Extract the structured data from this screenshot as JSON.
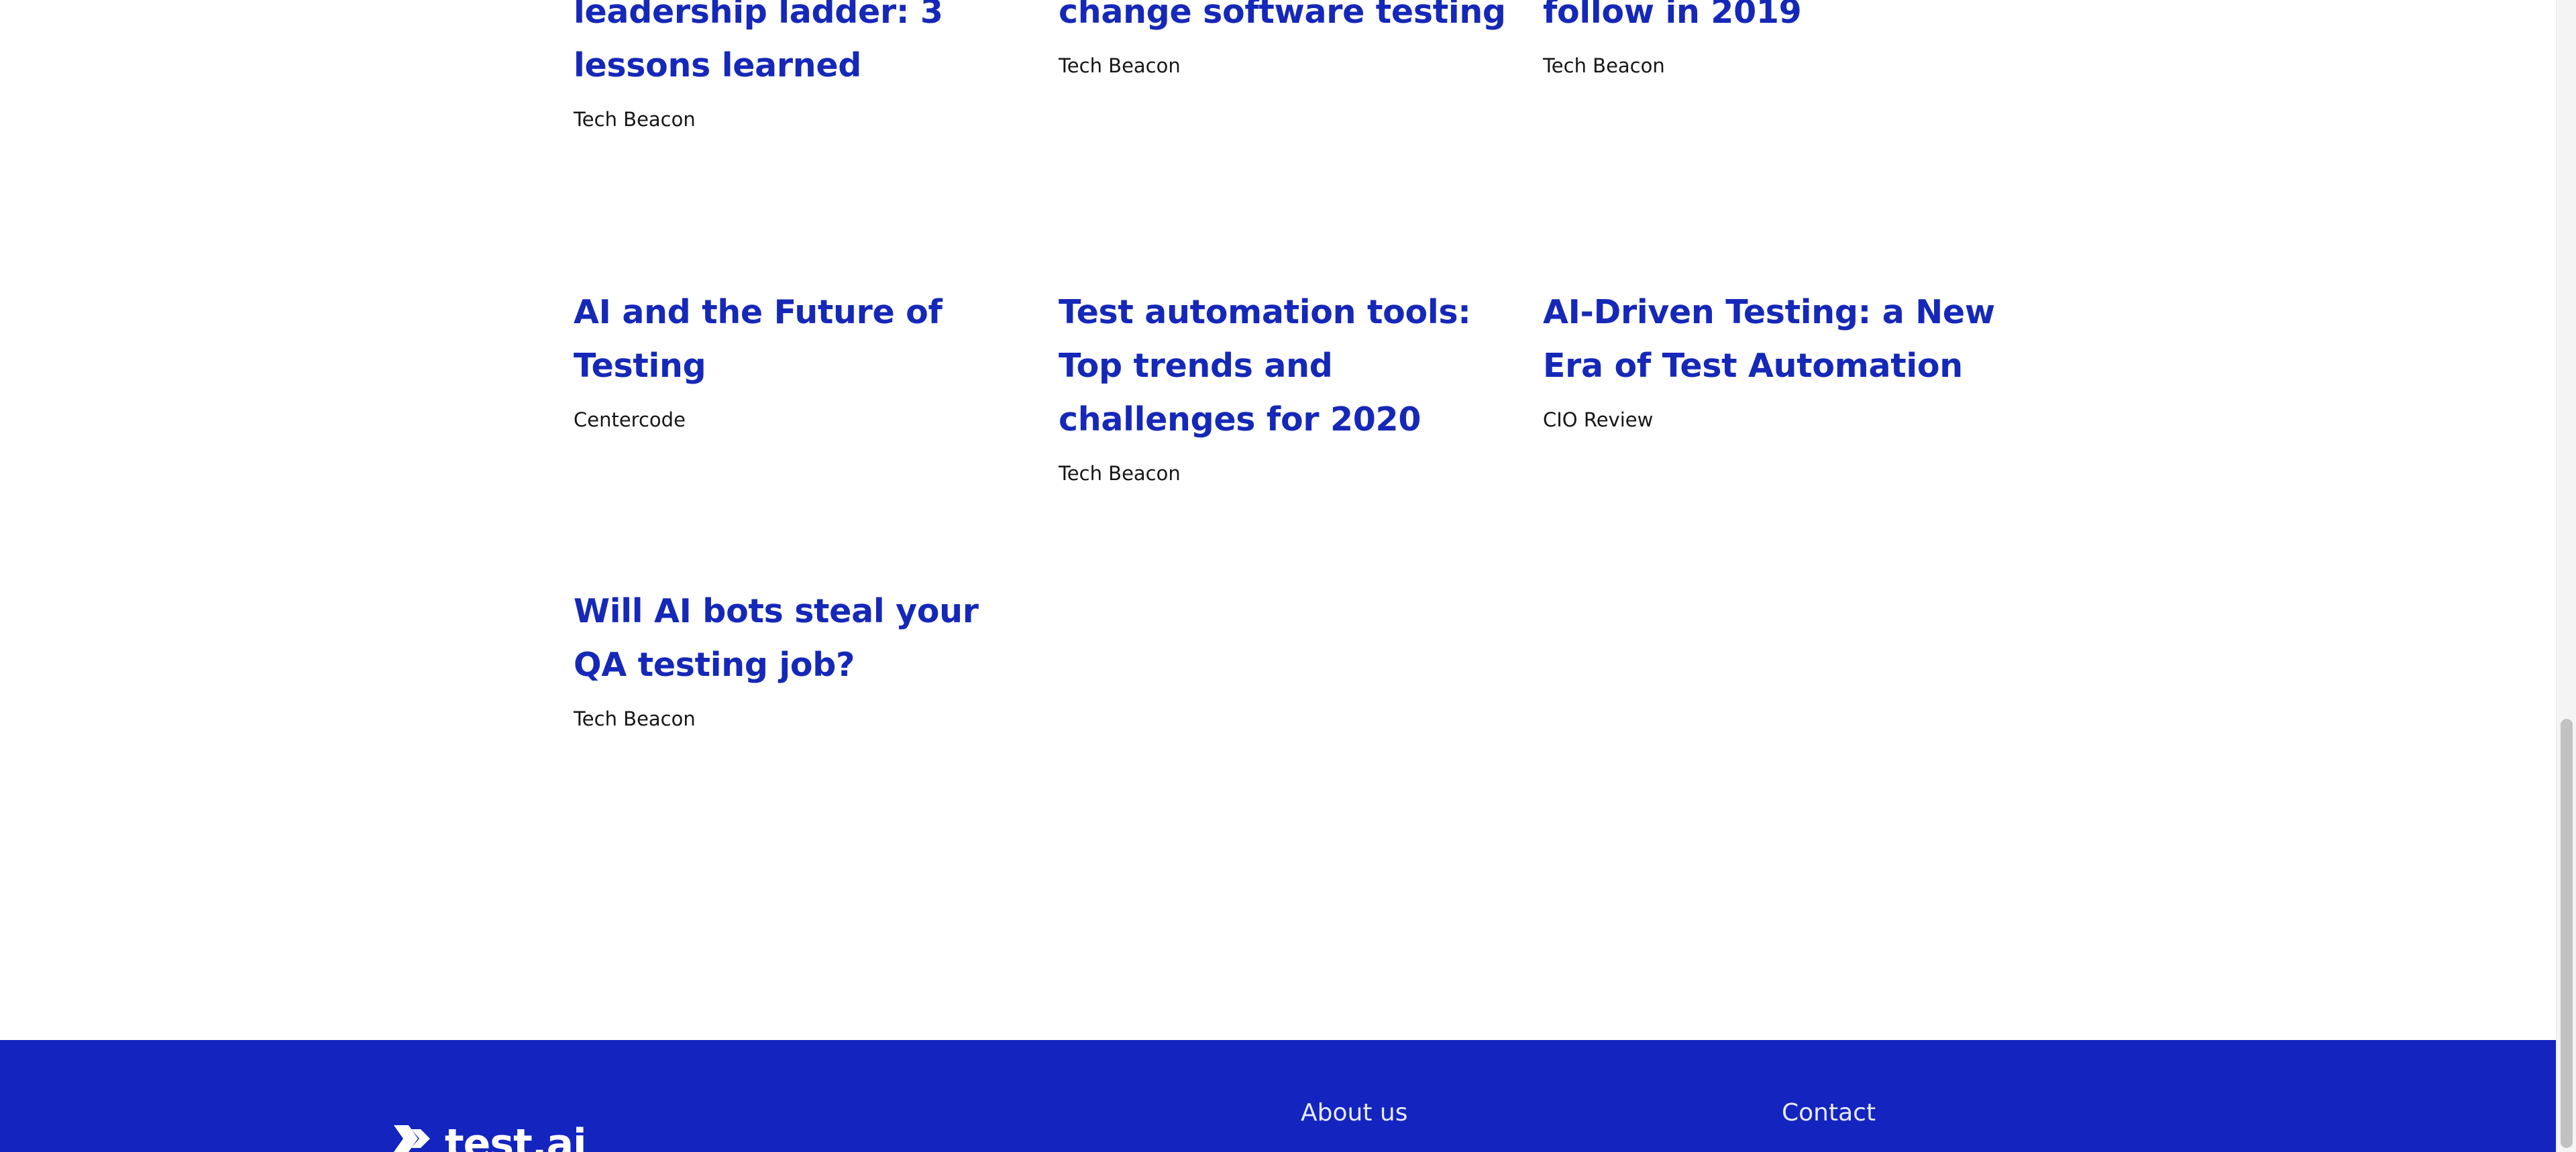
{
  "articles": [
    {
      "title": "leadership ladder: 3 lessons learned",
      "source": "Tech Beacon"
    },
    {
      "title": "change software testing",
      "source": "Tech Beacon"
    },
    {
      "title": "follow in 2019",
      "source": "Tech Beacon"
    },
    {
      "title": "AI and the Future of Testing",
      "source": "Centercode"
    },
    {
      "title": "Test automation tools: Top trends and challenges for 2020",
      "source": "Tech Beacon"
    },
    {
      "title": "AI-Driven Testing: a New Era of Test Automation",
      "source": "CIO Review"
    },
    {
      "title": "Will AI bots steal your QA testing job?",
      "source": "Tech Beacon"
    }
  ],
  "footer": {
    "logo_text": "test.ai",
    "logo_icon": "chevron-double-right-icon",
    "links": [
      "About us",
      "Contact"
    ]
  },
  "colors": {
    "link": "#1528b8",
    "text": "#161616",
    "footer_bg": "#1324bf",
    "footer_text": "#e8ebff"
  }
}
